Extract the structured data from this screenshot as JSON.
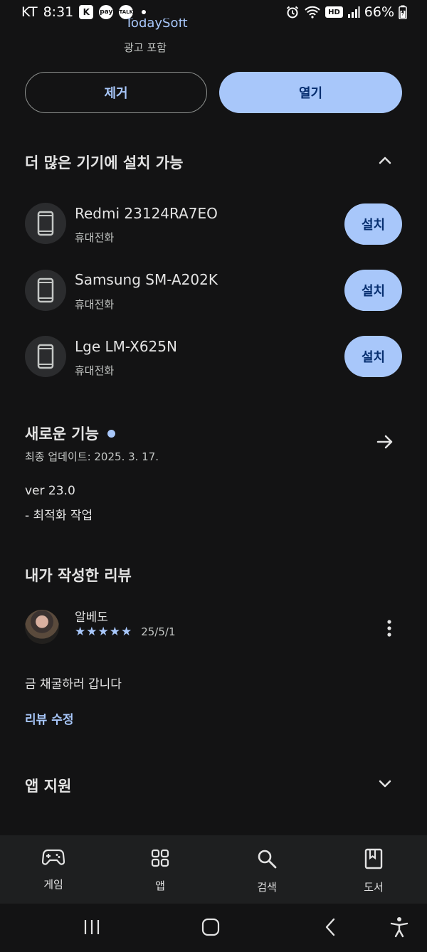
{
  "status_bar": {
    "carrier": "KT",
    "time": "8:31",
    "app_icon_k": "K",
    "pay_badge": "pay",
    "talk_badge": "TALK",
    "hd_badge": "HD",
    "battery": "66%"
  },
  "app_header": {
    "developer": "TodaySoft",
    "ads_notice": "광고 포함"
  },
  "actions": {
    "uninstall_label": "제거",
    "open_label": "열기"
  },
  "devices_section": {
    "title": "더 많은 기기에 설치 가능",
    "devices": [
      {
        "name": "Redmi 23124RA7EO",
        "type": "휴대전화",
        "button": "설치"
      },
      {
        "name": "Samsung SM-A202K",
        "type": "휴대전화",
        "button": "설치"
      },
      {
        "name": "Lge LM-X625N",
        "type": "휴대전화",
        "button": "설치"
      }
    ]
  },
  "whats_new": {
    "title": "새로운 기능",
    "last_updated": "최종 업데이트: 2025. 3. 17.",
    "version": "ver 23.0",
    "notes": "- 최적화 작업"
  },
  "my_review": {
    "title": "내가 작성한 리뷰",
    "reviewer": "알베도",
    "stars": "★★★★★",
    "rating": 5,
    "date": "25/5/1",
    "text": "금 채굴하러 갑니다",
    "edit_label": "리뷰 수정"
  },
  "app_support": {
    "title": "앱 지원"
  },
  "bottom_nav": {
    "items": [
      {
        "label": "게임",
        "icon": "gamepad-icon"
      },
      {
        "label": "앱",
        "icon": "apps-grid-icon"
      },
      {
        "label": "검색",
        "icon": "search-icon"
      },
      {
        "label": "도서",
        "icon": "book-icon"
      }
    ]
  },
  "colors": {
    "background": "#131314",
    "accent": "#a8c7fa",
    "nav_background": "#1e1f20"
  }
}
